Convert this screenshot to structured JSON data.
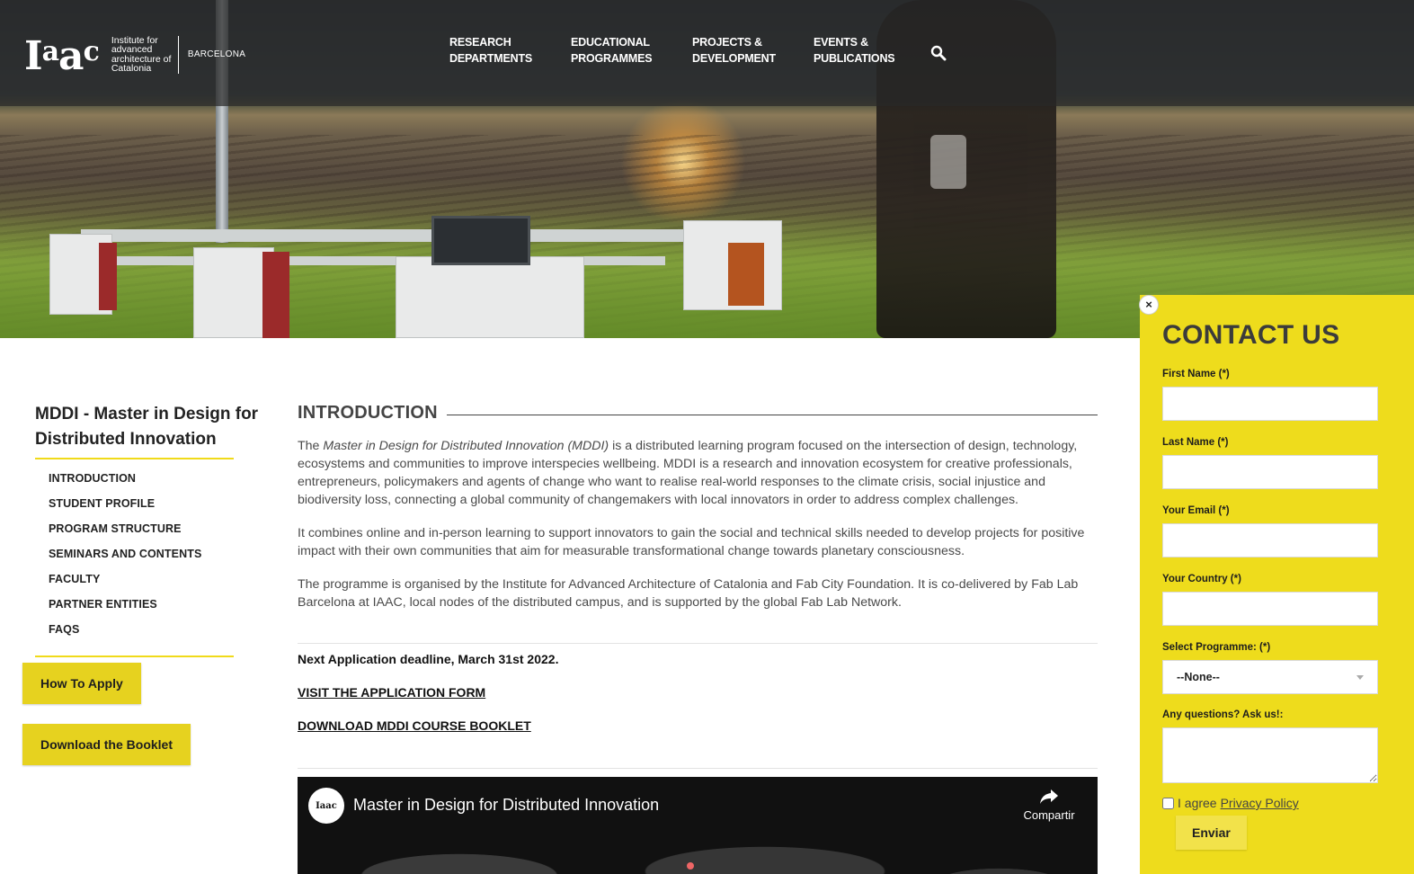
{
  "brand": {
    "logo_text": "Iaac",
    "institute": "Institute for advanced architecture of Catalonia",
    "city": "BARCELONA"
  },
  "nav": {
    "items": [
      {
        "line1": "RESEARCH",
        "line2": "DEPARTMENTS"
      },
      {
        "line1": "EDUCATIONAL",
        "line2": "PROGRAMMES"
      },
      {
        "line1": "PROJECTS &",
        "line2": "DEVELOPMENT"
      },
      {
        "line1": "EVENTS &",
        "line2": "PUBLICATIONS"
      }
    ],
    "search_icon": "search-icon"
  },
  "sidebar": {
    "title": "MDDI - Master in Design for Distributed Innovation",
    "items": [
      {
        "label": "INTRODUCTION"
      },
      {
        "label": "STUDENT PROFILE"
      },
      {
        "label": "PROGRAM STRUCTURE"
      },
      {
        "label": "SEMINARS AND CONTENTS"
      },
      {
        "label": "FACULTY"
      },
      {
        "label": "PARTNER ENTITIES"
      },
      {
        "label": "FAQs"
      }
    ],
    "apply_button": "How To Apply",
    "booklet_button": "Download the Booklet",
    "accent": "#e6d21f"
  },
  "main": {
    "heading": "INTRODUCTION",
    "p1_prefix": "The ",
    "p1_italic": "Master in Design for Distributed Innovation (MDDI)",
    "p1_rest": " is a distributed learning program focused on the intersection of design, technology, ecosystems and communities to improve interspecies wellbeing. MDDI is a research and innovation ecosystem for creative professionals, entrepreneurs, policymakers and agents of change who want to realise real-world responses to the climate crisis, social injustice and biodiversity loss, connecting a global community of changemakers with local innovators in order to address complex challenges.",
    "p2": "It combines online and in-person learning to support innovators to gain the social and technical skills needed to develop projects for positive impact with their own communities that aim for measurable transformational change towards planetary consciousness.",
    "p3": "The programme is organised by the Institute for Advanced Architecture of Catalonia and Fab City Foundation. It is co-delivered by Fab Lab Barcelona at IAAC, local nodes of the distributed campus, and is supported by the global Fab Lab Network.",
    "deadline": "Next Application deadline, March 31st 2022.",
    "link_form": "VISIT THE APPLICATION FORM",
    "link_booklet": "DOWNLOAD MDDI COURSE BOOKLET"
  },
  "video": {
    "title": "Master in Design for Distributed Innovation",
    "share_label": "Compartir",
    "channel_mark": "Iaac"
  },
  "contact": {
    "title": "CONTACT US",
    "close": "×",
    "first_name_label": "First Name (*)",
    "last_name_label": "Last Name (*)",
    "email_label": "Your Email (*)",
    "country_label": "Your Country (*)",
    "programme_label": "Select Programme: (*)",
    "programme_value": "--None--",
    "questions_label": "Any questions? Ask us!:",
    "agree_text": "I agree",
    "privacy_link": "Privacy Policy",
    "submit": "Enviar",
    "panel_color": "#eedc1c"
  }
}
